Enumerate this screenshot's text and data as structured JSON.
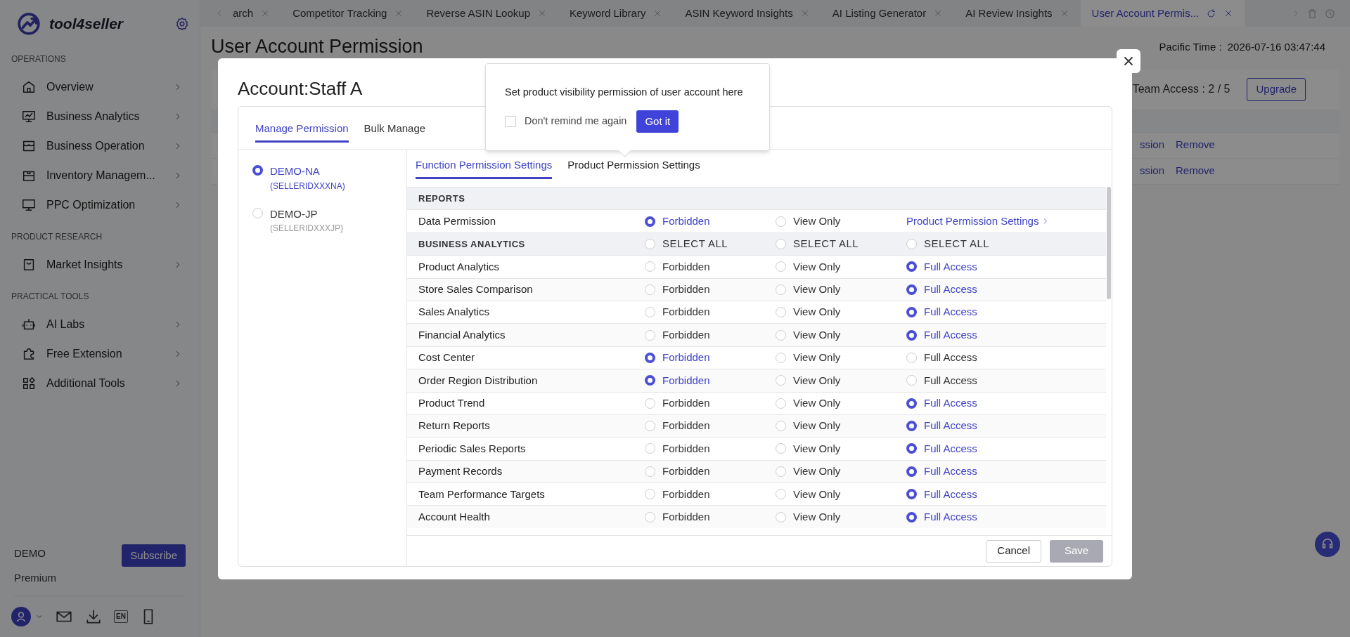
{
  "sidebar": {
    "brand": "tool4seller",
    "sections": [
      {
        "title": "OPERATIONS",
        "items": [
          {
            "label": "Overview"
          },
          {
            "label": "Business Analytics"
          },
          {
            "label": "Business Operation"
          },
          {
            "label": "Inventory Managem..."
          },
          {
            "label": "PPC Optimization"
          }
        ]
      },
      {
        "title": "PRODUCT RESEARCH",
        "items": [
          {
            "label": "Market Insights"
          }
        ]
      },
      {
        "title": "PRACTICAL TOOLS",
        "items": [
          {
            "label": "AI Labs"
          },
          {
            "label": "Free Extension"
          },
          {
            "label": "Additional Tools"
          }
        ]
      }
    ],
    "account": {
      "name": "DEMO",
      "plan": "Premium",
      "button": "Subscribe"
    },
    "footer_lang": "EN"
  },
  "tabs": [
    {
      "label": "arch",
      "selected": false
    },
    {
      "label": "Competitor Tracking",
      "selected": false
    },
    {
      "label": "Reverse ASIN Lookup",
      "selected": false
    },
    {
      "label": "Keyword Library",
      "selected": false
    },
    {
      "label": "ASIN Keyword Insights",
      "selected": false
    },
    {
      "label": "AI Listing Generator",
      "selected": false
    },
    {
      "label": "AI Review Insights",
      "selected": false
    },
    {
      "label": "User Account Permis...",
      "selected": true
    }
  ],
  "page": {
    "title": "User Account Permission",
    "time_label": "Pacific Time :",
    "time": "2026-07-16 03:47:44",
    "team_access": "Team Access : 2 / 5",
    "upgrade": "Upgrade",
    "rows": [
      {
        "cells": [
          "ssion",
          "Remove"
        ]
      },
      {
        "cells": [
          "ssion",
          "Remove"
        ]
      }
    ]
  },
  "modal": {
    "title": "Account:Staff A",
    "tabs": [
      {
        "label": "Manage Permission",
        "selected": true
      },
      {
        "label": "Bulk Manage",
        "selected": false
      }
    ],
    "accounts": [
      {
        "name": "DEMO-NA",
        "id": "(SELLERIDXXXNA)",
        "selected": true
      },
      {
        "name": "DEMO-JP",
        "id": "(SELLERIDXXXJP)",
        "selected": false
      }
    ],
    "subtabs": [
      {
        "label": "Function Permission Settings",
        "selected": true
      },
      {
        "label": "Product Permission Settings",
        "selected": false
      }
    ],
    "rows": [
      {
        "kind": "section",
        "label": "REPORTS"
      },
      {
        "kind": "row",
        "label": "Data Permission",
        "options": [
          {
            "label": "Forbidden",
            "selected": true
          },
          {
            "label": "View Only",
            "selected": false
          }
        ],
        "link": "Product Permission Settings"
      },
      {
        "kind": "select_all",
        "label": "BUSINESS ANALYTICS",
        "options": [
          {
            "label": "SELECT ALL",
            "selected": false
          },
          {
            "label": "SELECT ALL",
            "selected": false
          },
          {
            "label": "SELECT ALL",
            "selected": false
          }
        ]
      },
      {
        "kind": "row",
        "label": "Product Analytics",
        "options": [
          {
            "label": "Forbidden",
            "selected": false
          },
          {
            "label": "View Only",
            "selected": false
          },
          {
            "label": "Full Access",
            "selected": true
          }
        ]
      },
      {
        "kind": "row",
        "label": "Store Sales Comparison",
        "options": [
          {
            "label": "Forbidden",
            "selected": false
          },
          {
            "label": "View Only",
            "selected": false
          },
          {
            "label": "Full Access",
            "selected": true
          }
        ]
      },
      {
        "kind": "row",
        "label": "Sales Analytics",
        "options": [
          {
            "label": "Forbidden",
            "selected": false
          },
          {
            "label": "View Only",
            "selected": false
          },
          {
            "label": "Full Access",
            "selected": true
          }
        ]
      },
      {
        "kind": "row",
        "label": "Financial Analytics",
        "options": [
          {
            "label": "Forbidden",
            "selected": false
          },
          {
            "label": "View Only",
            "selected": false
          },
          {
            "label": "Full Access",
            "selected": true
          }
        ]
      },
      {
        "kind": "row",
        "label": "Cost Center",
        "options": [
          {
            "label": "Forbidden",
            "selected": true
          },
          {
            "label": "View Only",
            "selected": false
          },
          {
            "label": "Full Access",
            "selected": false
          }
        ]
      },
      {
        "kind": "row",
        "label": "Order Region Distribution",
        "options": [
          {
            "label": "Forbidden",
            "selected": true
          },
          {
            "label": "View Only",
            "selected": false
          },
          {
            "label": "Full Access",
            "selected": false
          }
        ]
      },
      {
        "kind": "row",
        "label": "Product Trend",
        "options": [
          {
            "label": "Forbidden",
            "selected": false
          },
          {
            "label": "View Only",
            "selected": false
          },
          {
            "label": "Full Access",
            "selected": true
          }
        ]
      },
      {
        "kind": "row",
        "label": "Return Reports",
        "options": [
          {
            "label": "Forbidden",
            "selected": false
          },
          {
            "label": "View Only",
            "selected": false
          },
          {
            "label": "Full Access",
            "selected": true
          }
        ]
      },
      {
        "kind": "row",
        "label": "Periodic Sales Reports",
        "options": [
          {
            "label": "Forbidden",
            "selected": false
          },
          {
            "label": "View Only",
            "selected": false
          },
          {
            "label": "Full Access",
            "selected": true
          }
        ]
      },
      {
        "kind": "row",
        "label": "Payment Records",
        "options": [
          {
            "label": "Forbidden",
            "selected": false
          },
          {
            "label": "View Only",
            "selected": false
          },
          {
            "label": "Full Access",
            "selected": true
          }
        ]
      },
      {
        "kind": "row",
        "label": "Team Performance Targets",
        "options": [
          {
            "label": "Forbidden",
            "selected": false
          },
          {
            "label": "View Only",
            "selected": false
          },
          {
            "label": "Full Access",
            "selected": true
          }
        ]
      },
      {
        "kind": "row",
        "label": "Account Health",
        "options": [
          {
            "label": "Forbidden",
            "selected": false
          },
          {
            "label": "View Only",
            "selected": false
          },
          {
            "label": "Full Access",
            "selected": true
          }
        ]
      }
    ],
    "cancel": "Cancel",
    "save": "Save",
    "save_disabled": true
  },
  "popover": {
    "text": "Set product visibility permission of user account here",
    "checkbox": {
      "label": "Don't remind me again",
      "checked": false
    },
    "button": "Got it"
  }
}
